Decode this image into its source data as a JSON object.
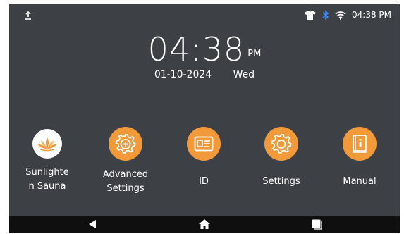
{
  "status_bar": {
    "time": "04:38 PM",
    "left_icon": "upload-arrow-icon",
    "icons": [
      "tshirt-icon",
      "bluetooth-icon",
      "wifi-icon"
    ]
  },
  "clock": {
    "time": "04:38",
    "ampm": "PM",
    "date": "01-10-2024",
    "weekday": "Wed"
  },
  "apps": [
    {
      "label": "Sunlighte\nn Sauna",
      "icon": "lotus-icon"
    },
    {
      "label": "Advanced\nSettings",
      "icon": "gear-plus-icon"
    },
    {
      "label": "ID",
      "icon": "id-card-icon"
    },
    {
      "label": "Settings",
      "icon": "gear-icon"
    },
    {
      "label": "Manual",
      "icon": "manual-book-icon"
    }
  ],
  "nav": [
    "back-icon",
    "home-icon",
    "recents-icon"
  ],
  "colors": {
    "background": "#3d4045",
    "accent": "#f29a3a",
    "nav_bar": "#0f0f10",
    "bluetooth": "#3f8cff"
  }
}
